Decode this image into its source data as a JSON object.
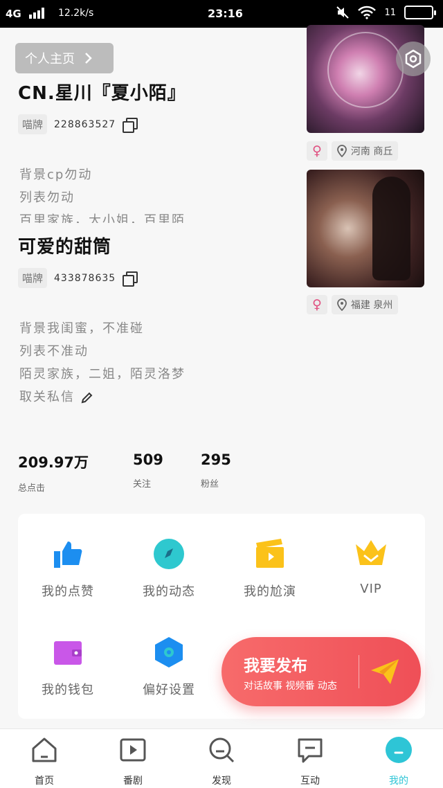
{
  "status_bar": {
    "network": "4G",
    "speed": "12.2k/s",
    "time": "23:16",
    "battery": "11"
  },
  "header": {
    "home_button_label": "个人主页",
    "settings_icon": "hexagon-settings-icon"
  },
  "profiles": [
    {
      "name": "CN.星川『夏小陌』",
      "tag": "喵牌",
      "uid": "228863527",
      "gender_symbol": "♀",
      "location": "河南 商丘",
      "bio_lines": [
        "背景cp勿动",
        "列表勿动",
        "百里家族，大小姐，百里陌"
      ]
    },
    {
      "name": "可爱的甜筒",
      "tag": "喵牌",
      "uid": "433878635",
      "gender_symbol": "♀",
      "location": "福建 泉州",
      "bio_lines": [
        "背景我闺蜜，不准碰",
        "列表不准动",
        "陌灵家族，二姐，陌灵洛梦",
        "取关私信"
      ]
    }
  ],
  "stats": [
    {
      "value": "209.97万",
      "label": "总点击"
    },
    {
      "value": "509",
      "label": "关注"
    },
    {
      "value": "295",
      "label": "粉丝"
    }
  ],
  "features": [
    {
      "label": "我的点赞",
      "icon": "thumbs-up-icon"
    },
    {
      "label": "我的动态",
      "icon": "compass-icon"
    },
    {
      "label": "我的尬演",
      "icon": "clapperboard-icon"
    },
    {
      "label": "VIP",
      "icon": "crown-icon"
    },
    {
      "label": "我的钱包",
      "icon": "wallet-icon"
    },
    {
      "label": "偏好设置",
      "icon": "hexagon-settings-icon"
    }
  ],
  "publish": {
    "title": "我要发布",
    "subtitle": "对话故事 视频番 动态"
  },
  "tabs": [
    {
      "label": "首页",
      "icon": "home-icon"
    },
    {
      "label": "番剧",
      "icon": "play-icon"
    },
    {
      "label": "发现",
      "icon": "search-icon"
    },
    {
      "label": "互动",
      "icon": "chat-icon"
    },
    {
      "label": "我的",
      "icon": "profile-icon",
      "active": true
    }
  ],
  "colors": {
    "accent": "#2ec5d6",
    "publish": "#f25a5f",
    "female": "#e05080"
  }
}
